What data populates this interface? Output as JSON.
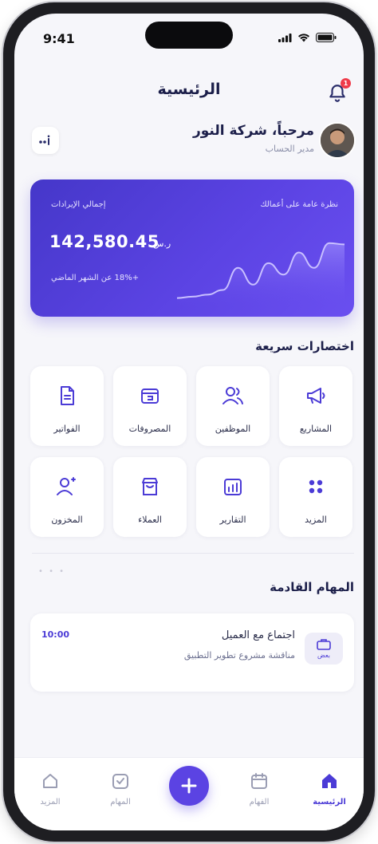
{
  "status_bar": {
    "time": "9:41"
  },
  "header": {
    "title": "الرئيسية",
    "notification_count": "1"
  },
  "greeting": {
    "title": "مرحباً، شركة النور",
    "subtitle": "مدير الحساب"
  },
  "summary_card": {
    "overview_label": "نظرة عامة على أعمالك",
    "total_label": "إجمالي الإيرادات",
    "amount": "142,580.45",
    "currency": "ر.س",
    "change_text": "+18% عن الشهر الماضي",
    "trend": [
      0.1,
      0.12,
      0.15,
      0.22,
      0.55,
      0.3,
      0.62,
      0.45,
      0.78,
      0.55,
      0.92,
      0.9
    ]
  },
  "shortcuts": {
    "title": "اختصارات سريعة",
    "items": [
      {
        "label": "المشاريع",
        "icon": "megaphone-icon"
      },
      {
        "label": "الموظفين",
        "icon": "users-icon"
      },
      {
        "label": "المصروفات",
        "icon": "wallet-icon"
      },
      {
        "label": "الفواتير",
        "icon": "invoice-icon"
      },
      {
        "label": "المزيد",
        "icon": "grid-dots-icon"
      },
      {
        "label": "التقارير",
        "icon": "chart-icon"
      },
      {
        "label": "العملاء",
        "icon": "shop-icon"
      },
      {
        "label": "المخزون",
        "icon": "inventory-icon"
      }
    ]
  },
  "tasks": {
    "title": "المهام القادمة",
    "items": [
      {
        "time": "10:00",
        "title": "اجتماع مع العميل",
        "description": "مناقشة مشروع تطوير التطبيق",
        "badge": "بعض"
      }
    ]
  },
  "bottom_nav": {
    "items": [
      {
        "label": "الرئيسية",
        "icon": "home-icon",
        "active": true
      },
      {
        "label": "الفهام",
        "icon": "calendar-icon",
        "active": false
      },
      {
        "label": "المهام",
        "icon": "tasks-icon",
        "active": false
      },
      {
        "label": "المزيد",
        "icon": "more-icon",
        "active": false
      }
    ],
    "fab_symbol": "+"
  },
  "colors": {
    "primary": "#5b43e3",
    "title": "#1c1f4a",
    "badge": "#ef3b4a"
  }
}
